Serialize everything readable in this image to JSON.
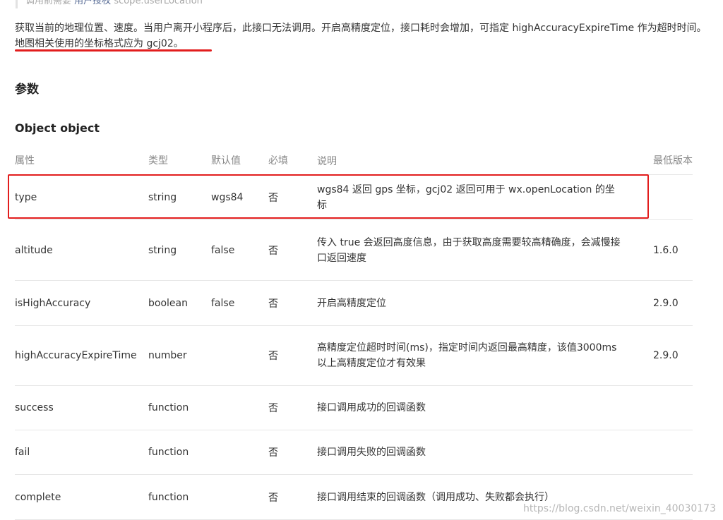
{
  "tip": {
    "prefix": "调用前需要",
    "link": "用户授权",
    "scope": "scope.userLocation"
  },
  "description": {
    "line1": "获取当前的地理位置、速度。当用户离开小程序后，此接口无法调用。开启高精度定位，接口耗时会增加，可指定 highAccuracyExpireTime 作为超时时间。",
    "line2": "地图相关使用的坐标格式应为 gcj02。"
  },
  "section_title": "参数",
  "object_title": "Object object",
  "table": {
    "headers": [
      "属性",
      "类型",
      "默认值",
      "必填",
      "说明",
      "最低版本"
    ],
    "rows": [
      {
        "name": "type",
        "type": "string",
        "default": "wgs84",
        "required": "否",
        "desc": "wgs84 返回 gps 坐标，gcj02 返回可用于 wx.openLocation 的坐标",
        "version": ""
      },
      {
        "name": "altitude",
        "type": "string",
        "default": "false",
        "required": "否",
        "desc": "传入 true 会返回高度信息，由于获取高度需要较高精确度，会减慢接口返回速度",
        "version": "1.6.0"
      },
      {
        "name": "isHighAccuracy",
        "type": "boolean",
        "default": "false",
        "required": "否",
        "desc": "开启高精度定位",
        "version": "2.9.0"
      },
      {
        "name": "highAccuracyExpireTime",
        "type": "number",
        "default": "",
        "required": "否",
        "desc": "高精度定位超时时间(ms)，指定时间内返回最高精度，该值3000ms以上高精度定位才有效果",
        "version": "2.9.0"
      },
      {
        "name": "success",
        "type": "function",
        "default": "",
        "required": "否",
        "desc": "接口调用成功的回调函数",
        "version": ""
      },
      {
        "name": "fail",
        "type": "function",
        "default": "",
        "required": "否",
        "desc": "接口调用失败的回调函数",
        "version": ""
      },
      {
        "name": "complete",
        "type": "function",
        "default": "",
        "required": "否",
        "desc": "接口调用结束的回调函数（调用成功、失败都会执行）",
        "version": ""
      }
    ]
  },
  "watermark": "https://blog.csdn.net/weixin_40030173",
  "colors": {
    "annotation_red": "#e21d1d",
    "link": "#576b95",
    "header_text": "#888888"
  }
}
